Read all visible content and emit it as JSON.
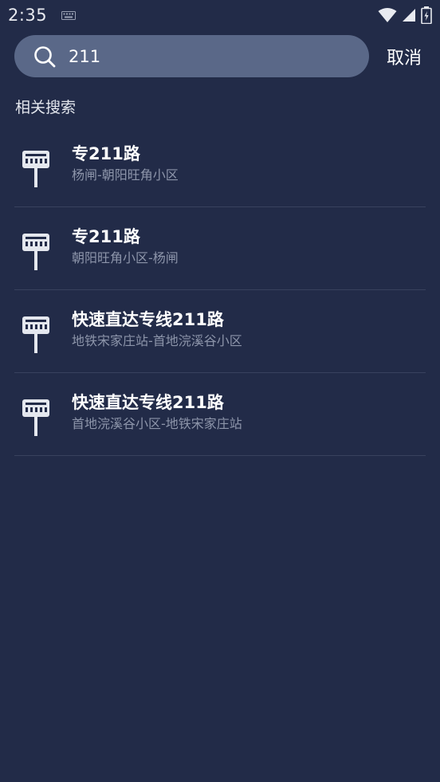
{
  "status_bar": {
    "time": "2:35",
    "icons": [
      "keyboard-icon",
      "wifi-icon",
      "signal-icon",
      "battery-icon"
    ]
  },
  "search": {
    "value": "211",
    "placeholder": "",
    "cancel_label": "取消"
  },
  "section": {
    "title": "相关搜索"
  },
  "results": [
    {
      "title": "专211路",
      "subtitle": "杨闸-朝阳旺角小区"
    },
    {
      "title": "专211路",
      "subtitle": "朝阳旺角小区-杨闸"
    },
    {
      "title": "快速直达专线211路",
      "subtitle": "地铁宋家庄站-首地浣溪谷小区"
    },
    {
      "title": "快速直达专线211路",
      "subtitle": "首地浣溪谷小区-地铁宋家庄站"
    }
  ],
  "colors": {
    "background": "#222b48",
    "search_box": "#5a6888",
    "divider": "#39425e",
    "subtitle": "#8d95aa"
  }
}
